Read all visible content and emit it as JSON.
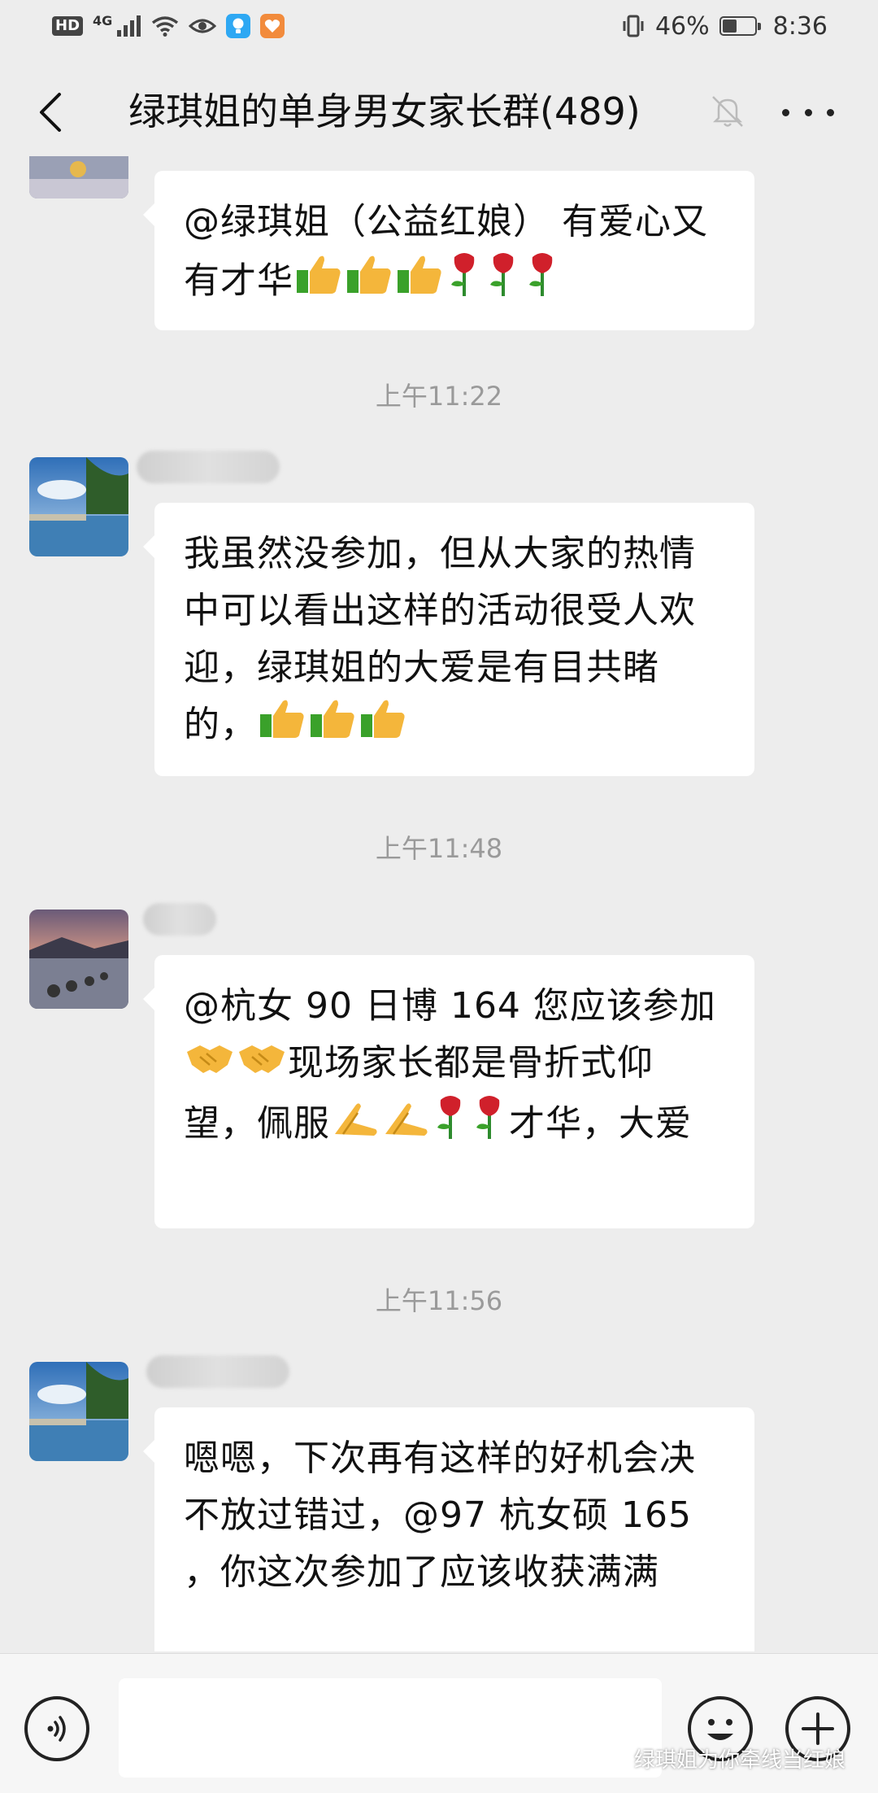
{
  "status_bar": {
    "hd": "HD",
    "network": "4G",
    "battery_text": "46%",
    "battery_level": 0.46,
    "time": "8:36"
  },
  "nav": {
    "title": "绿琪姐的单身男女家长群(489)"
  },
  "messages": [
    {
      "text": "@绿琪姐（公益红娘） 有爱心又有才华",
      "emoji_tail": [
        "thumbs-up",
        "thumbs-up",
        "thumbs-up",
        "rose",
        "rose",
        "rose"
      ]
    },
    {
      "text": "我虽然没参加，但从大家的热情中可以看出这样的活动很受人欢迎，绿琪姐的大爱是有目共睹的，",
      "emoji_tail": [
        "thumbs-up",
        "thumbs-up",
        "thumbs-up"
      ]
    },
    {
      "text_a": "@杭女 90 日博 164  您应该参加",
      "emoji_a": [
        "handshake",
        "handshake"
      ],
      "text_b": "现场家长都是骨折式仰望，佩服",
      "emoji_b": [
        "clap",
        "clap",
        "rose",
        "rose"
      ],
      "text_c": "才华，大爱"
    },
    {
      "text": "嗯嗯，下次再有这样的好机会决不放过错过，@97 杭女硕 165 ，你这次参加了应该收获满满"
    }
  ],
  "timestamps": [
    "上午11:22",
    "上午11:48",
    "上午11:56"
  ],
  "input": {
    "placeholder": ""
  },
  "watermark": "绿琪姐为你牵线当红娘",
  "colors": {
    "background": "#ededed",
    "bubble": "#ffffff",
    "timestamp": "#9a9a9a"
  }
}
